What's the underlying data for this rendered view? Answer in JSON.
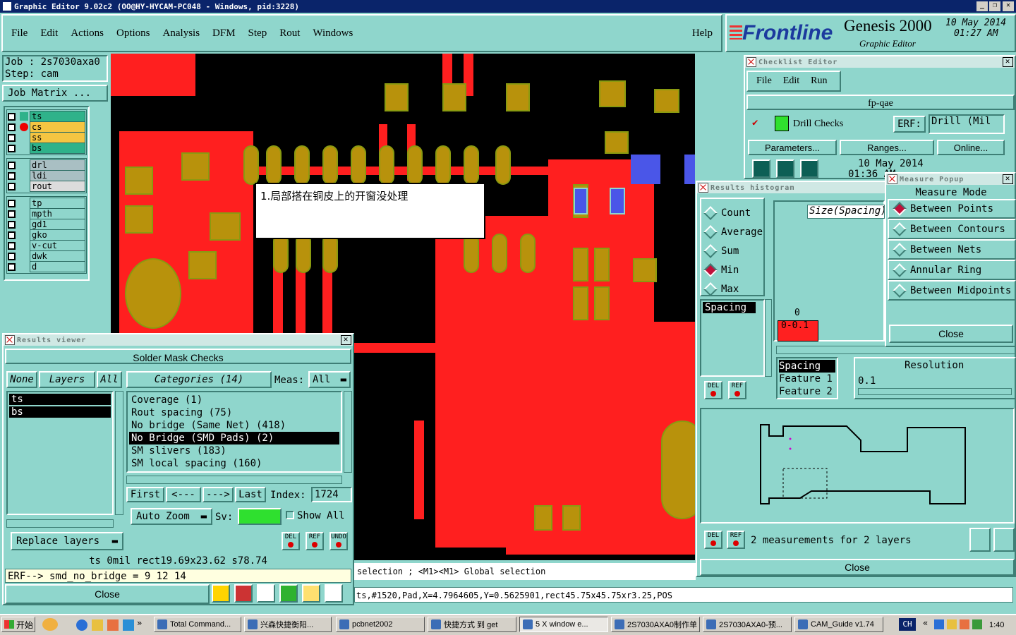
{
  "titlebar": {
    "title": "Graphic Editor 9.02c2 (OO@HY-HYCAM-PC048 - Windows, pid:3228)"
  },
  "menubar": {
    "items": [
      "File",
      "Edit",
      "Actions",
      "Options",
      "Analysis",
      "DFM",
      "Step",
      "Rout",
      "Windows"
    ],
    "help": "Help"
  },
  "brand": {
    "logo": "Frontline",
    "product": "Genesis 2000",
    "subtitle": "Graphic Editor",
    "date": "10 May 2014",
    "time": "01:27 AM"
  },
  "job": {
    "job": "Job : 2s7030axa0",
    "step": "Step: cam",
    "matrix_btn": "Job Matrix ..."
  },
  "layers": {
    "group1": [
      {
        "name": "ts",
        "color": "#2fb28a"
      },
      {
        "name": "cs",
        "color": "#f5c542"
      },
      {
        "name": "ss",
        "color": "#f5c542"
      },
      {
        "name": "bs",
        "color": "#2fb28a"
      }
    ],
    "group2": [
      {
        "name": "drl",
        "color": "#a9bfc3"
      },
      {
        "name": "ldi",
        "color": "#a9bfc3"
      },
      {
        "name": "rout",
        "color": "#dcdcdc"
      }
    ],
    "group3": [
      {
        "name": "tp"
      },
      {
        "name": "mpth"
      },
      {
        "name": "gd1"
      },
      {
        "name": "gko"
      },
      {
        "name": "v-cut"
      },
      {
        "name": "dwk"
      },
      {
        "name": "d"
      }
    ]
  },
  "annotation": {
    "text": "1.局部搭在铜皮上的开窗没处理"
  },
  "results_viewer": {
    "title": "Results viewer",
    "header": "Solder Mask Checks",
    "none_btn": "None",
    "layers_btn": "Layers",
    "all_btn": "All",
    "categories_btn": "Categories (14)",
    "meas_label": "Meas:",
    "meas_value": "All",
    "layer_list": [
      "ts",
      "bs"
    ],
    "categories": [
      "Coverage (1)",
      "Rout spacing (75)",
      "No bridge (Same Net) (418)",
      "No Bridge (SMD Pads) (2)",
      "SM slivers (183)",
      "SM local spacing (160)"
    ],
    "selected_index": 3,
    "first": "First",
    "prev": "<---",
    "next": "--->",
    "last": "Last",
    "index_label": "Index:",
    "index_value": "1724",
    "auto_zoom": "Auto Zoom",
    "sv_label": "Sv:",
    "show_all": "Show All",
    "replace_layers": "Replace layers",
    "status1": "ts 0mil   rect19.69x23.62   s78.74",
    "status2": "ERF--> smd_no_bridge = 9 12 14",
    "close": "Close"
  },
  "checklist": {
    "title": "Checklist Editor",
    "menu": [
      "File",
      "Edit",
      "Run"
    ],
    "name": "fp-qae",
    "check": "Drill Checks",
    "erf_label": "ERF:",
    "erf_value": "Drill (Mil",
    "params": "Parameters...",
    "ranges": "Ranges...",
    "online": "Online...",
    "date": "10 May 2014",
    "time": "01:36 AM"
  },
  "histogram": {
    "title": "Results histogram",
    "modes": [
      "Count",
      "Average",
      "Sum",
      "Min",
      "Max"
    ],
    "selected": "Min",
    "size_label": "Size(Spacing)",
    "zero": "0",
    "bin_label": "0-0.1",
    "list_item": "Spacing",
    "fields": [
      "Spacing",
      "Feature 1",
      "Feature 2"
    ],
    "resolution_label": "Resolution",
    "resolution_value": "0.1",
    "measurements": "2 measurements for 2 layers",
    "close": "Close"
  },
  "measure": {
    "title": "Measure Popup",
    "header": "Measure Mode",
    "modes": [
      "Between Points",
      "Between Contours",
      "Between Nets",
      "Annular Ring",
      "Between Midpoints"
    ],
    "selected": "Between Points",
    "close": "Close"
  },
  "statusbar": {
    "prompt": "selection ; <M1><M1> Global selection",
    "info": "ts,#1520,Pad,X=4.7964605,Y=0.5625901,rect45.75x45.75xr3.25,POS"
  },
  "taskbar": {
    "start": "开始",
    "items": [
      "Total Command...",
      "兴森快捷衡阳...",
      "pcbnet2002",
      "快捷方式 到 get",
      "5 X window e...",
      "2S7030AXA0制作单",
      "2S7030AXA0-预...",
      "CAM_Guide v1.74"
    ],
    "lang": "CH",
    "clock": "1:40"
  }
}
